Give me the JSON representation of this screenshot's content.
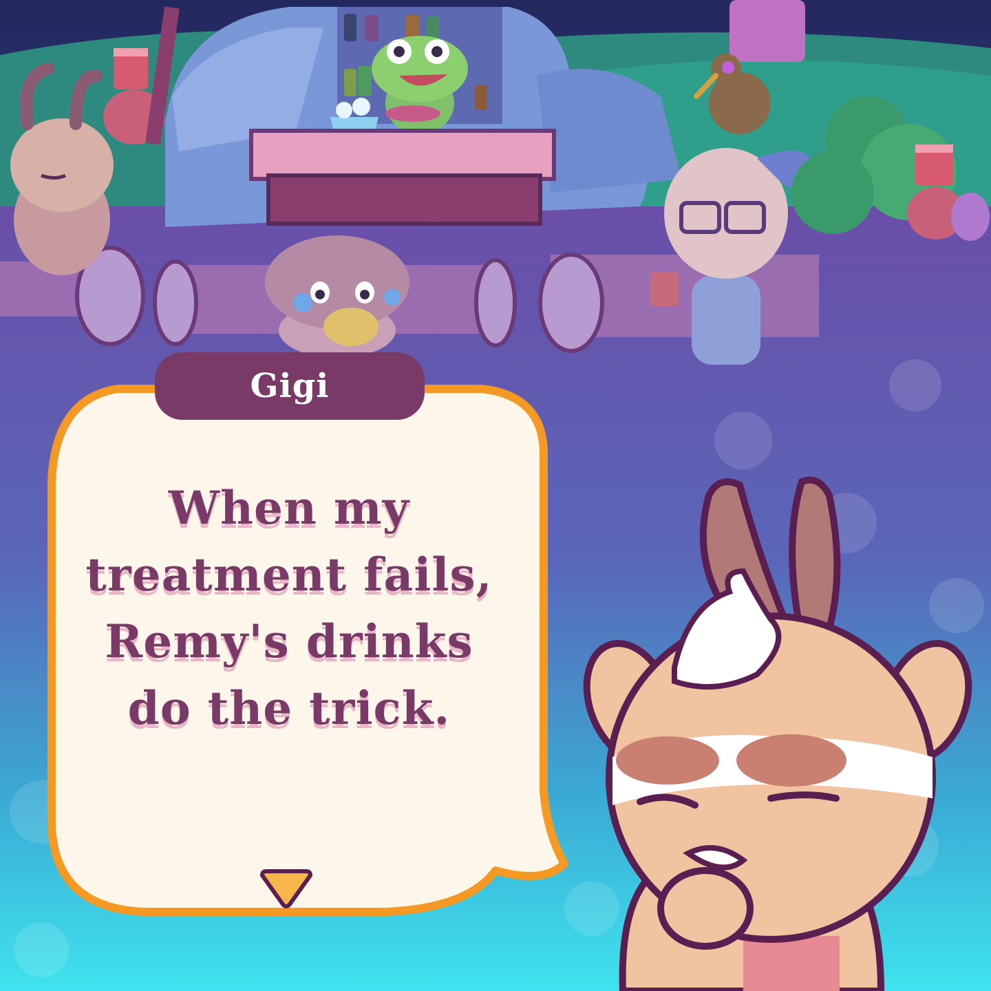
{
  "dialogue": {
    "speaker": "Gigi",
    "text": "When my treatment fails, Remy's drinks do the trick.",
    "advance_icon": "chevron-down-icon"
  },
  "colors": {
    "sky_top": "#2a2c6e",
    "ground_top": "#6a4ea8",
    "ground_bottom": "#3fe3ee",
    "bubble_fill": "#fdf6ea",
    "bubble_border": "#f49a24",
    "accent_plum": "#7a3a68",
    "text_shadow": "#e8b6c6",
    "advance_arrow": "#f7b64a"
  },
  "scene": {
    "location": "beach bar",
    "characters": [
      "goat-guest",
      "crab-left",
      "frog-bartender",
      "kitten",
      "kiwi-bird",
      "ram-guest",
      "crab-right",
      "gigi-portrait"
    ]
  }
}
